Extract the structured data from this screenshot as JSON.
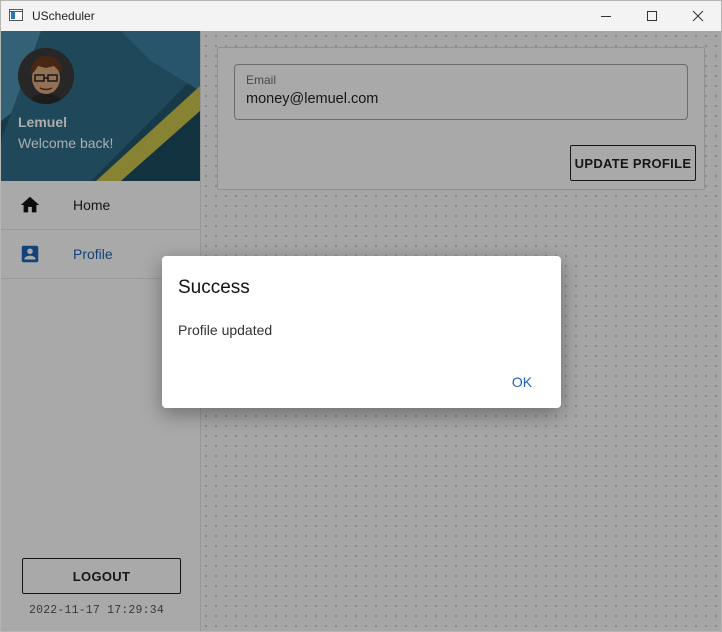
{
  "window": {
    "title": "UScheduler"
  },
  "user": {
    "name": "Lemuel",
    "welcome": "Welcome back!"
  },
  "nav": {
    "items": [
      {
        "label": "Home",
        "icon": "home-icon",
        "active": false
      },
      {
        "label": "Profile",
        "icon": "account-box-icon",
        "active": true
      }
    ]
  },
  "sidebar": {
    "logout_label": "LOGOUT",
    "timestamp": "2022-11-17 17:29:34"
  },
  "profile_form": {
    "email_label": "Email",
    "email_value": "money@lemuel.com",
    "update_label": "UPDATE PROFILE"
  },
  "dialog": {
    "title": "Success",
    "message": "Profile updated",
    "ok_label": "OK"
  },
  "colors": {
    "accent": "#1e63b4",
    "banner": "#24546a"
  }
}
